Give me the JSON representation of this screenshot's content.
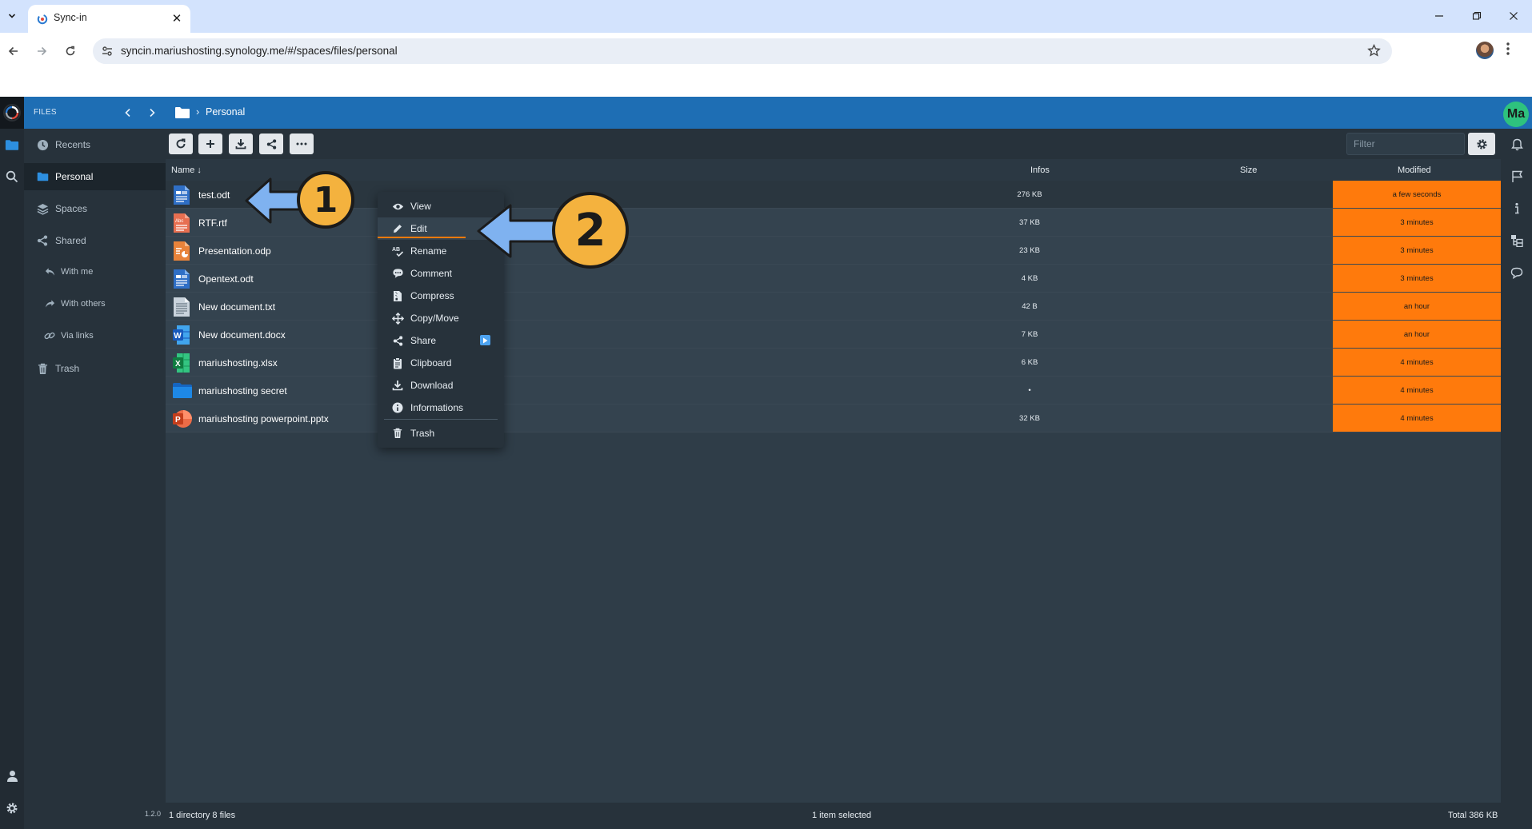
{
  "browser": {
    "tab_title": "Sync-in",
    "url": "syncin.mariushosting.synology.me/#/spaces/files/personal"
  },
  "app": {
    "section": "FILES",
    "breadcrumb": "Personal",
    "user_initials": "Ma",
    "version": "1.2.0",
    "accent_color": "#1e6eb4",
    "highlight_color": "#ff7a0c"
  },
  "sidebar": {
    "items": [
      {
        "label": "Recents",
        "icon": "clock-icon"
      },
      {
        "label": "Personal",
        "icon": "folder-icon"
      },
      {
        "label": "Spaces",
        "icon": "layers-icon"
      },
      {
        "label": "Shared",
        "icon": "share-icon"
      },
      {
        "label": "With me",
        "icon": "reply-icon"
      },
      {
        "label": "With others",
        "icon": "forward-icon"
      },
      {
        "label": "Via links",
        "icon": "link-icon"
      },
      {
        "label": "Trash",
        "icon": "trash-icon"
      }
    ]
  },
  "toolbar": {
    "filter_placeholder": "Filter"
  },
  "table": {
    "columns": {
      "name": "Name",
      "infos": "Infos",
      "size": "Size",
      "modified": "Modified"
    },
    "rows": [
      {
        "name": "test.odt",
        "size": "276 KB",
        "modified": "a few seconds",
        "type": "odt"
      },
      {
        "name": "RTF.rtf",
        "size": "37 KB",
        "modified": "3 minutes",
        "type": "rtf"
      },
      {
        "name": "Presentation.odp",
        "size": "23 KB",
        "modified": "3 minutes",
        "type": "odp"
      },
      {
        "name": "Opentext.odt",
        "size": "4 KB",
        "modified": "3 minutes",
        "type": "odt"
      },
      {
        "name": "New document.txt",
        "size": "42 B",
        "modified": "an hour",
        "type": "txt"
      },
      {
        "name": "New document.docx",
        "size": "7 KB",
        "modified": "an hour",
        "type": "docx"
      },
      {
        "name": "mariushosting.xlsx",
        "size": "6 KB",
        "modified": "4 minutes",
        "type": "xlsx"
      },
      {
        "name": "mariushosting secret",
        "size": "•",
        "modified": "4 minutes",
        "type": "folder"
      },
      {
        "name": "mariushosting powerpoint.pptx",
        "size": "32 KB",
        "modified": "4 minutes",
        "type": "pptx"
      }
    ]
  },
  "context_menu": {
    "items": [
      {
        "label": "View",
        "icon": "eye-icon"
      },
      {
        "label": "Edit",
        "icon": "pencil-icon"
      },
      {
        "label": "Rename",
        "icon": "rename-icon"
      },
      {
        "label": "Comment",
        "icon": "comment-icon"
      },
      {
        "label": "Compress",
        "icon": "archive-icon"
      },
      {
        "label": "Copy/Move",
        "icon": "move-icon"
      },
      {
        "label": "Share",
        "icon": "share-icon"
      },
      {
        "label": "Clipboard",
        "icon": "clipboard-icon"
      },
      {
        "label": "Download",
        "icon": "download-icon"
      },
      {
        "label": "Informations",
        "icon": "info-icon"
      },
      {
        "label": "Trash",
        "icon": "trash-icon"
      }
    ]
  },
  "status": {
    "left": "1 directory 8 files",
    "center": "1 item selected",
    "right": "Total 386 KB"
  },
  "annotations": {
    "step1": "1",
    "step2": "2"
  }
}
